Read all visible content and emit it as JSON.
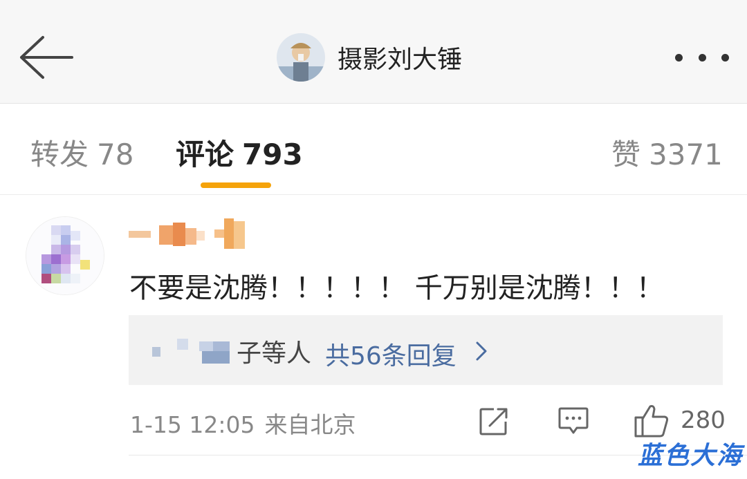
{
  "header": {
    "author_name": "摄影刘大锤",
    "back_icon": "arrow-left-icon",
    "more_icon": "more-dots-icon"
  },
  "tabs": [
    {
      "label": "转发",
      "count": "78",
      "active": false
    },
    {
      "label": "评论",
      "count": "793",
      "active": true
    },
    {
      "label": "赞",
      "count": "3371",
      "active": false
    }
  ],
  "comment": {
    "text": "不要是沈腾！！！！！ 千万别是沈腾！！！",
    "replies": {
      "names_suffix": "子等人",
      "link_label": "共56条回复"
    },
    "date": "1-15 12:05",
    "source": "来自北京",
    "like_count": "280"
  },
  "colors": {
    "accent": "#f5a30a",
    "link": "#4a6ca0",
    "watermark": "#2b6fd6"
  },
  "watermark": "蓝色大海"
}
